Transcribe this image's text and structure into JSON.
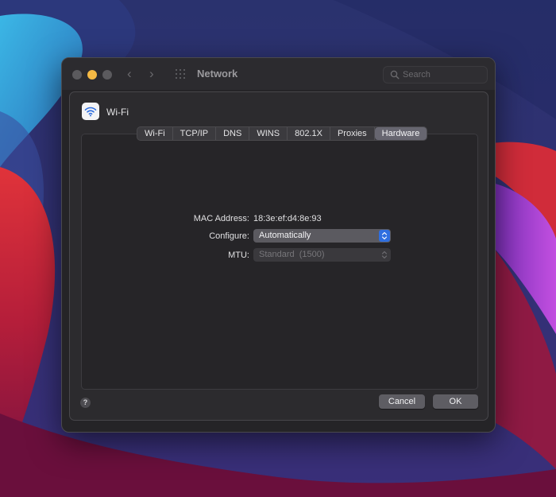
{
  "window": {
    "title": "Network"
  },
  "search": {
    "placeholder": "Search",
    "value": ""
  },
  "interface": {
    "name": "Wi-Fi",
    "icon": "wifi-icon"
  },
  "tabs": [
    {
      "label": "Wi-Fi"
    },
    {
      "label": "TCP/IP"
    },
    {
      "label": "DNS"
    },
    {
      "label": "WINS"
    },
    {
      "label": "802.1X"
    },
    {
      "label": "Proxies"
    },
    {
      "label": "Hardware",
      "active": true
    }
  ],
  "hardware": {
    "mac_label": "MAC Address:",
    "mac_value": "18:3e:ef:d4:8e:93",
    "configure_label": "Configure:",
    "configure_value": "Automatically",
    "mtu_label": "MTU:",
    "mtu_value": "Standard  (1500)"
  },
  "buttons": {
    "help": "?",
    "cancel": "Cancel",
    "ok": "OK"
  },
  "colors": {
    "accent": "#2f6fe0",
    "minimize_light": "#f5b944",
    "window_bg": "#252427",
    "selected_tab": "#676670"
  }
}
